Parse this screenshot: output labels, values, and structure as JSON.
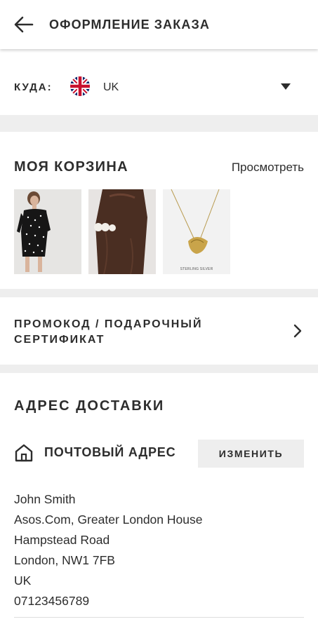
{
  "header": {
    "title": "ОФОРМЛЕНИЕ ЗАКАЗА",
    "back_icon": "arrow-left-icon"
  },
  "destination": {
    "label": "КУДА:",
    "country": "UK",
    "flag_icon": "uk-flag-icon",
    "dropdown_icon": "caret-down-icon"
  },
  "basket": {
    "title": "МОЯ КОРЗИНА",
    "view_link": "Просмотреть",
    "items": [
      {
        "kind": "off-shoulder dotted dress"
      },
      {
        "kind": "pearl hair clip"
      },
      {
        "kind": "gold necklace",
        "caption": "STERLING SILVER"
      }
    ]
  },
  "promo": {
    "label": "ПРОМОКОД / ПОДАРОЧНЫЙ СЕРТИФИКАТ",
    "chevron_icon": "chevron-right-icon"
  },
  "delivery": {
    "title": "АДРЕС ДОСТАВКИ",
    "postal_title": "ПОЧТОВЫЙ АДРЕС",
    "change_button": "ИЗМЕНИТЬ",
    "home_icon": "home-icon",
    "address_lines": [
      "John Smith",
      "Asos.Com, Greater London House",
      "Hampstead Road",
      "London, NW1 7FB",
      "UK",
      "07123456789"
    ]
  },
  "colors": {
    "text": "#2d2d2d",
    "separator": "#eeeeee",
    "button_bg": "#eeeeee",
    "flag_blue": "#012169",
    "flag_red": "#c8102e"
  }
}
